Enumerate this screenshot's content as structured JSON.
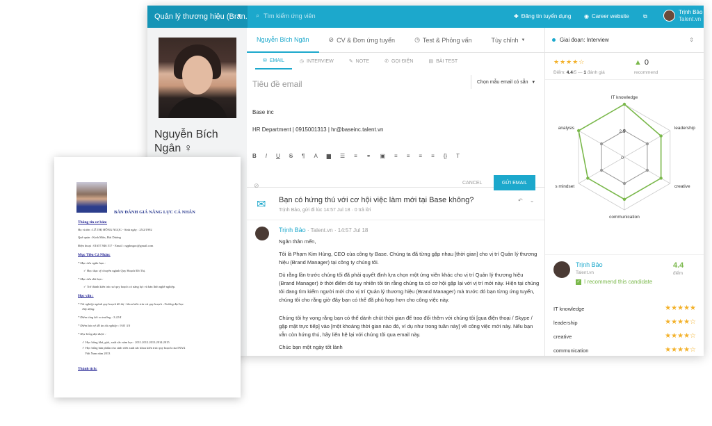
{
  "topbar": {
    "brand": "Quản lý thương hiệu (Bran...",
    "search_placeholder": "Tìm kiếm ứng viên",
    "post_job": "Đăng tin tuyển dụng",
    "career_site": "Career website",
    "user_name": "Trịnh Bảo",
    "user_company": "Talent.vn"
  },
  "candidate": {
    "name": "Nguyễn Bích Ngân ♀"
  },
  "tabs": [
    {
      "label": "Nguyễn Bích Ngân"
    },
    {
      "label": "CV & Đơn ứng tuyển",
      "icon": "paperclip-icon"
    },
    {
      "label": "Test & Phỏng vấn",
      "icon": "clock-icon"
    },
    {
      "label": "Tùy chỉnh",
      "icon": "chevron-down-icon"
    }
  ],
  "stage": {
    "label": "Giai đoạn: Interview"
  },
  "subtabs": [
    "EMAIL",
    "INTERVIEW",
    "NOTE",
    "GỌI ĐIỆN",
    "BÀI TEST"
  ],
  "compose": {
    "subject_placeholder": "Tiêu đề email",
    "template_label": "Chọn mẫu email có sẵn",
    "body_line1": "Base inc",
    "body_line2": "HR Department | 0915001313 | hr@baseinc.talent.vn",
    "cancel": "CANCEL",
    "send": "GỬI EMAIL"
  },
  "thread": {
    "subject": "Bạn có hứng thú với cơ hội việc làm mới tại Base không?",
    "meta": "Trịnh Bảo, gửi đi lúc 14:57 Jul 18 · 0 trả lời",
    "sender": "Trịnh Bảo",
    "sender_meta": " · Talent.vn · 14:57 Jul 18",
    "greeting": "Ngân thân mến,",
    "p1": "Tôi là Phạm Kim Hùng, CEO của công ty Base. Chúng ta đã từng gặp nhau [thời gian] cho vị trí Quản lý thương hiệu (Brand Manager) tại công ty chúng tôi.",
    "p2": "Dù rằng lần trước chúng tôi đã phải quyết định lựa chọn một ứng viên khác cho vị trí Quản lý thương hiệu (Brand Manager) ở thời điểm đó tuy nhiên tôi tin rằng chúng ta có cơ hội gặp lại với vị trí mới này. Hiện tại chúng tôi đang tìm kiếm người mới cho vị trí Quản lý thương hiệu (Brand Manager) mà trước đó bạn từng ứng tuyển, chúng tôi cho rằng giờ đây bạn có thể đã phù hợp hơn cho công việc này.",
    "p3": "Chúng tôi hy vọng rằng bạn có thể dành chút thời gian để trao đổi thêm với chúng tôi [qua điện thoại / Skype / gặp mặt trực tiếp] vào [một khoảng thời gian nào đó, ví dụ như trong tuần này] về công việc mới này. Nếu bạn vẫn còn hứng thú, hãy liên hệ lại với chúng tôi qua email này.",
    "p4": "Chúc bạn một ngày tốt lành"
  },
  "rating": {
    "stars": "★★★★☆",
    "score_label": "Điểm: ",
    "score": "4.4",
    "score_suffix": "/5 — ",
    "count": "1",
    "count_suffix": " đánh giá",
    "recommend_count": "0",
    "recommend_label": "recommend"
  },
  "chart_data": {
    "type": "radar",
    "axes": [
      "IT knowledge",
      "leadership",
      "creative",
      "communication",
      "s mindset",
      "analysis"
    ],
    "tick_labels": [
      "2.5",
      "0"
    ],
    "range": [
      0,
      5
    ],
    "series": [
      {
        "values": [
          5,
          4,
          4,
          4,
          4,
          5
        ],
        "color": "#7ab84b"
      },
      {
        "values": [
          2.5,
          2.5,
          2.5,
          2.5,
          2.5,
          2.5
        ],
        "color": "#999999"
      }
    ]
  },
  "review": {
    "name": "Trịnh Bảo",
    "company": "Talent.vn",
    "recommend": "I recommend this candidate",
    "score": "4.4",
    "score_label": "điểm",
    "criteria": [
      {
        "label": "IT knowledge",
        "stars": "★★★★★"
      },
      {
        "label": "leadership",
        "stars": "★★★★☆"
      },
      {
        "label": "creative",
        "stars": "★★★★☆"
      },
      {
        "label": "communication",
        "stars": "★★★★☆"
      }
    ]
  },
  "doc": {
    "title": "BẢN ĐÁNH GIÁ NĂNG LỰC CÁ NHÂN",
    "h1": "Thông tin cơ bản:",
    "l1": "Họ và tên : LÊ THỊ HỒNG NGỌC - Sinh ngày : 25/2/1992",
    "l2": "Quê quán : Kinh Môn, Hải Dương",
    "l3": "Điện thoại : 01657.946 517 - Email : ngpbngoc@gmail.com",
    "h2": "Mục Tiêu Cá Nhân:",
    "l4": "* Mục tiêu ngắn hạn :",
    "l5": "✓ Học thạc sỹ chuyên ngành Quy Hoạch Đô Thị.",
    "l6": "* Mục tiêu dài hạn :",
    "l7": "✓ Trở thành kiến trúc sư quy hoạch có năng lực và bản lĩnh nghề nghiệp.",
    "h3": "Học vấn :",
    "l8": "* Tốt nghiệp ngành quy hoạch đô thị - khoa kiến trúc và quy hoạch –Trường đại học",
    "l9": "Xây dựng.",
    "l10": "* Điểm tổng kết ra trường : 3.22/4",
    "l11": "* Điểm bảo vệ đồ án tốt nghiệp : 9.03 /10",
    "l12": "* Học bổng đạt được :",
    "l13": "✓ Học bổng khá, giỏi, xuất sắc năm học : 2011.2012.2013.2014.2015",
    "l14": "✓ Học bổng bản phẩm cho sinh viên xuất sắc khoa kiến trúc quy hoạch của INAX",
    "l15": "Việt Nam năm 2013",
    "h4": "Thành tích:"
  }
}
